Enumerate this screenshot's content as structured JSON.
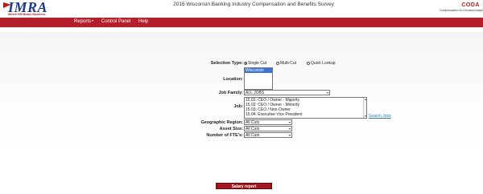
{
  "header": {
    "logo_text": "IMRA",
    "logo_tagline": "Where HR Means Business.",
    "survey_title": "2016 Wisconsin Banking Industry Compensation and Benefits Survey",
    "coda_logo": "CODA",
    "coda_tagline": "Compensation On-Demand Analytics"
  },
  "nav": {
    "items": [
      {
        "label": "Reports"
      },
      {
        "label": "Control Panel"
      },
      {
        "label": "Help"
      }
    ]
  },
  "form": {
    "selection_type": {
      "label": "Selection Type:",
      "options": [
        "Single Cut",
        "Multi-Cut",
        "Quick Lookup"
      ],
      "selected": "Single Cut"
    },
    "location": {
      "label": "Location:",
      "options": [
        "Wisconsin"
      ],
      "selected": "Wisconsin"
    },
    "job_family": {
      "label": "Job Family:",
      "value": "ALL JOBS"
    },
    "job": {
      "label": "Job:",
      "options": [
        "15.01: CEO / Owner - Majority",
        "15.02: CEO / Owner - Minority",
        "15.03: CEO / Non-Owner",
        "15.04: Executive Vice President"
      ],
      "search_link": "Search Jobs"
    },
    "geographic_region": {
      "label": "Geographic Region:",
      "value": "All Cuts"
    },
    "asset_size": {
      "label": "Asset Size:",
      "value": "All Cuts"
    },
    "number_of_ftes": {
      "label": "Number of FTE's:",
      "value": "All Cuts"
    }
  },
  "actions": {
    "salary_report_label": "Salary report"
  },
  "colors": {
    "nav_red": "#b31f2b",
    "button_red": "#a6161d",
    "selected_blue": "#3875d7",
    "logo_blue": "#1e3a8a",
    "link_blue": "#2f7fb8"
  }
}
